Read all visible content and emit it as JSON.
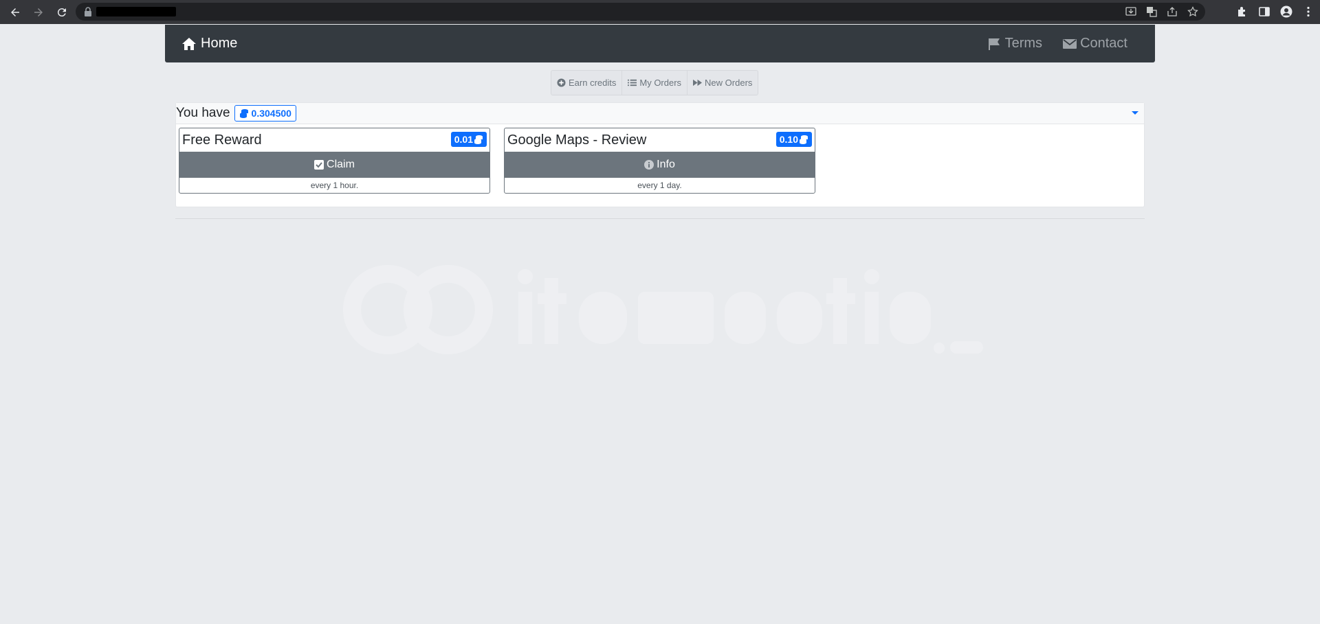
{
  "navbar": {
    "brand": "Home",
    "links": [
      {
        "label": "Terms",
        "icon": "flag-icon"
      },
      {
        "label": "Contact",
        "icon": "envelope-icon"
      }
    ]
  },
  "subnav": [
    {
      "label": "Earn credits",
      "icon": "plus-circle-icon"
    },
    {
      "label": "My Orders",
      "icon": "list-icon"
    },
    {
      "label": "New Orders",
      "icon": "fast-forward-icon"
    }
  ],
  "credits": {
    "label": "You have",
    "balance": "0.304500"
  },
  "cards": [
    {
      "title": "Free Reward",
      "reward": "0.01",
      "action": "Claim",
      "action_icon": "check-square-icon",
      "frequency": "every 1 hour."
    },
    {
      "title": "Google Maps - Review",
      "reward": "0.10",
      "action": "Info",
      "action_icon": "info-circle-icon",
      "frequency": "every 1 day."
    }
  ],
  "colors": {
    "navbar": "#343a40",
    "primary": "#0d6efd",
    "secondary": "#6c757d",
    "background": "#e9ebee"
  }
}
